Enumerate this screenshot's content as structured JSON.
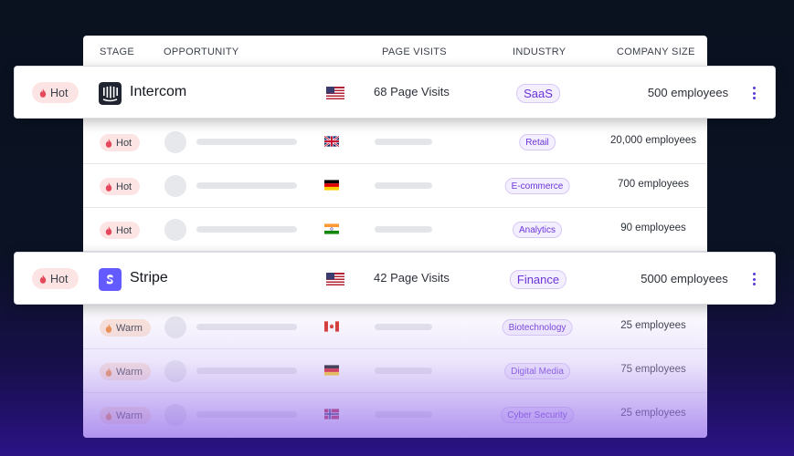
{
  "headers": {
    "stage": "STAGE",
    "opportunity": "OPPORTUNITY",
    "page_visits": "PAGE VISITS",
    "industry": "INDUSTRY",
    "company_size": "COMPANY SIZE"
  },
  "colors": {
    "accent": "#6b35d8",
    "hot_badge_bg": "#fde4e4",
    "warm_badge_bg": "#fde6d6",
    "flame_hot": "#e4485a",
    "flame_warm": "#ee8a3c",
    "intercom_logo": "#1f2430",
    "stripe_logo": "#635bff"
  },
  "highlight_cards": [
    {
      "stage": "Hot",
      "company": "Intercom",
      "logo_icon": "intercom-logo-icon",
      "flag_icon": "us-flag-icon",
      "page_visits": "68 Page Visits",
      "industry": "SaaS",
      "company_size": "500 employees"
    },
    {
      "stage": "Hot",
      "company": "Stripe",
      "logo_icon": "stripe-logo-icon",
      "flag_icon": "us-flag-icon",
      "page_visits": "42 Page Visits",
      "industry": "Finance",
      "company_size": "5000 employees"
    }
  ],
  "rows": [
    {
      "stage": "Hot",
      "flag_icon": "uk-flag-icon",
      "industry": "Retail",
      "company_size": "20,000 employees"
    },
    {
      "stage": "Hot",
      "flag_icon": "germany-flag-icon",
      "industry": "E-commerce",
      "company_size": "700 employees"
    },
    {
      "stage": "Hot",
      "flag_icon": "india-flag-icon",
      "industry": "Analytics",
      "company_size": "90 employees"
    },
    {
      "stage": "Warm",
      "flag_icon": "canada-flag-icon",
      "industry": "Biotechnology",
      "company_size": "25 employees"
    },
    {
      "stage": "Warm",
      "flag_icon": "germany-flag-icon",
      "industry": "Digital Media",
      "company_size": "75 employees"
    },
    {
      "stage": "Warm",
      "flag_icon": "norway-flag-icon",
      "industry": "Cyber Security",
      "company_size": "25 employees"
    }
  ]
}
